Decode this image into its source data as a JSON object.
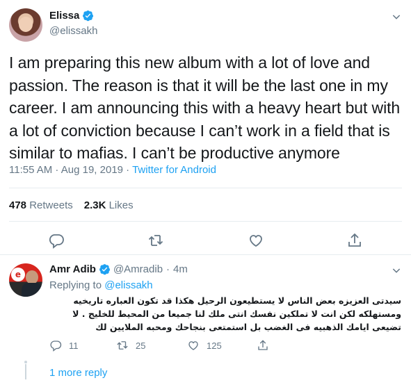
{
  "tweet": {
    "author_name": "Elissa",
    "author_handle": "@elissakh",
    "text": "I am preparing this new album with a lot of love and passion. The reason is that it will be the last one in my career. I am announcing this with a heavy heart but with a lot of conviction because I can’t work in a field that is similar to mafias. I can’t be productive anymore",
    "time": "11:55 AM · Aug 19, 2019 ·",
    "source": "Twitter for Android",
    "retweets_count": "478",
    "retweets_label": "Retweets",
    "likes_count": "2.3K",
    "likes_label": "Likes"
  },
  "reply": {
    "author_name": "Amr Adib",
    "author_handle": "@Amradib",
    "separator": "·",
    "age": "4m",
    "replying_prefix": "Replying to",
    "replying_handle": "@elissakh",
    "text": "سيدتى العزيزه بعض الناس لا يستطيعون الرحيل هكذا قد تكون العباره تاريخيه ومستهلكه لكن انت لا تملكين نفسك انتى ملك لنا جميعا من المحيط للخليج . لا تضيعى ايامك الذهبيه فى الغضب بل استمتعى بنجاحك ومحبه الملايين لك",
    "avatar_logo": "e",
    "reply_count": "11",
    "retweet_count": "25",
    "like_count": "125",
    "more_replies": "1 more reply"
  },
  "colors": {
    "text": "#14171a",
    "secondary": "#657786",
    "accent": "#1da1f2",
    "border": "#e6ecf0"
  },
  "icons": [
    "verified-badge-icon",
    "chevron-down-icon",
    "reply-icon",
    "retweet-icon",
    "like-icon",
    "share-icon"
  ]
}
